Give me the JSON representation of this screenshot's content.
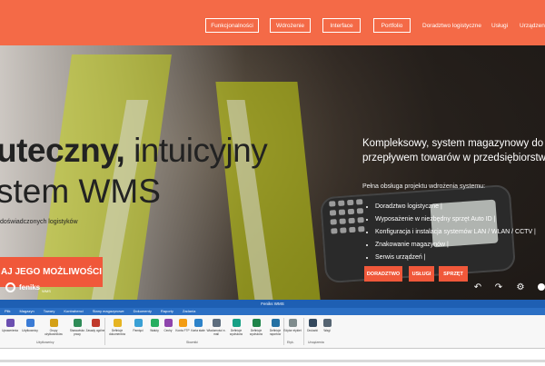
{
  "header": {
    "nav": [
      "Funkcjonalności",
      "Wdrożenie",
      "Interface",
      "Portfolio"
    ],
    "nav_plain": [
      "Doradztwo logistyczne",
      "Usługi",
      "Urządzenia"
    ]
  },
  "hero": {
    "headline_bold": "uteczny,",
    "headline_rest": " intuicyjny",
    "headline_line2": "stem WMS",
    "subline": "doświadczonych logistyków",
    "cta_label": "AJ JEGO MOŻLIWOŚCI",
    "right_title_line1": "Kompleksowy, system magazynowy do zar",
    "right_title_line2": "przepływem towarów w przedsiębiorstwac",
    "right_small": "Pełna obsługa projektu wdrożenia systemu:",
    "bullets": [
      "Doradztwo logistyczne |",
      "Wyposażenie w niezbędny sprzęt Auto ID |",
      "Konfiguracja i instalacja systemów LAN / WLAN / CCTV |",
      "Znakowanie magazynów |",
      "Serwis urządzeń |"
    ],
    "small_buttons": [
      "DORADZTWO",
      "USŁUGI",
      "SPRZĘT"
    ]
  },
  "logo": {
    "name": "feniks",
    "tag": "WMS"
  },
  "controls": {
    "prev": "↶",
    "next": "↷",
    "settings": "⚙"
  },
  "app": {
    "title": "Feniks WMS",
    "tabs": [
      "Plik",
      "Magazyn",
      "Towary",
      "Kontrahenci",
      "Stany magazynowe",
      "Dokumenty",
      "Raporty",
      "Zadania"
    ],
    "ribbon": [
      {
        "label": "Uprawnienia",
        "color": "#6b4fb0"
      },
      {
        "label": "Użytkownicy",
        "color": "#3a7bd5"
      },
      {
        "label": "Grupy użytkowników",
        "color": "#d4a017"
      },
      {
        "label": "Stanowisko pracy",
        "color": "#2e8b57"
      },
      {
        "label": "Zasady ogólne",
        "color": "#c0392b"
      },
      {
        "label": "Definicje dokumentów",
        "color": "#e6b422"
      },
      {
        "label": "Pamięci",
        "color": "#3aa0d5"
      },
      {
        "label": "Waluty",
        "color": "#27ae60"
      },
      {
        "label": "Cechy",
        "color": "#8e44ad"
      },
      {
        "label": "Konta FTP",
        "color": "#f39c12"
      },
      {
        "label": "Karta stałe",
        "color": "#2c82c9"
      },
      {
        "label": "Wiadomości e-mail",
        "color": "#5d6d7e"
      },
      {
        "label": "Definicje wydruków",
        "color": "#16a085"
      },
      {
        "label": "Definicje wydruków",
        "color": "#1e8449"
      },
      {
        "label": "Definicje raportów",
        "color": "#2471a3"
      },
      {
        "label": "Edytor etykiet",
        "color": "#7f8c8d"
      },
      {
        "label": "Drukarki",
        "color": "#34495e"
      },
      {
        "label": "Wagi",
        "color": "#566573"
      }
    ],
    "groups": [
      "Użytkownicy",
      "Słowniki",
      "Etyk.",
      "Urządzenia"
    ]
  }
}
